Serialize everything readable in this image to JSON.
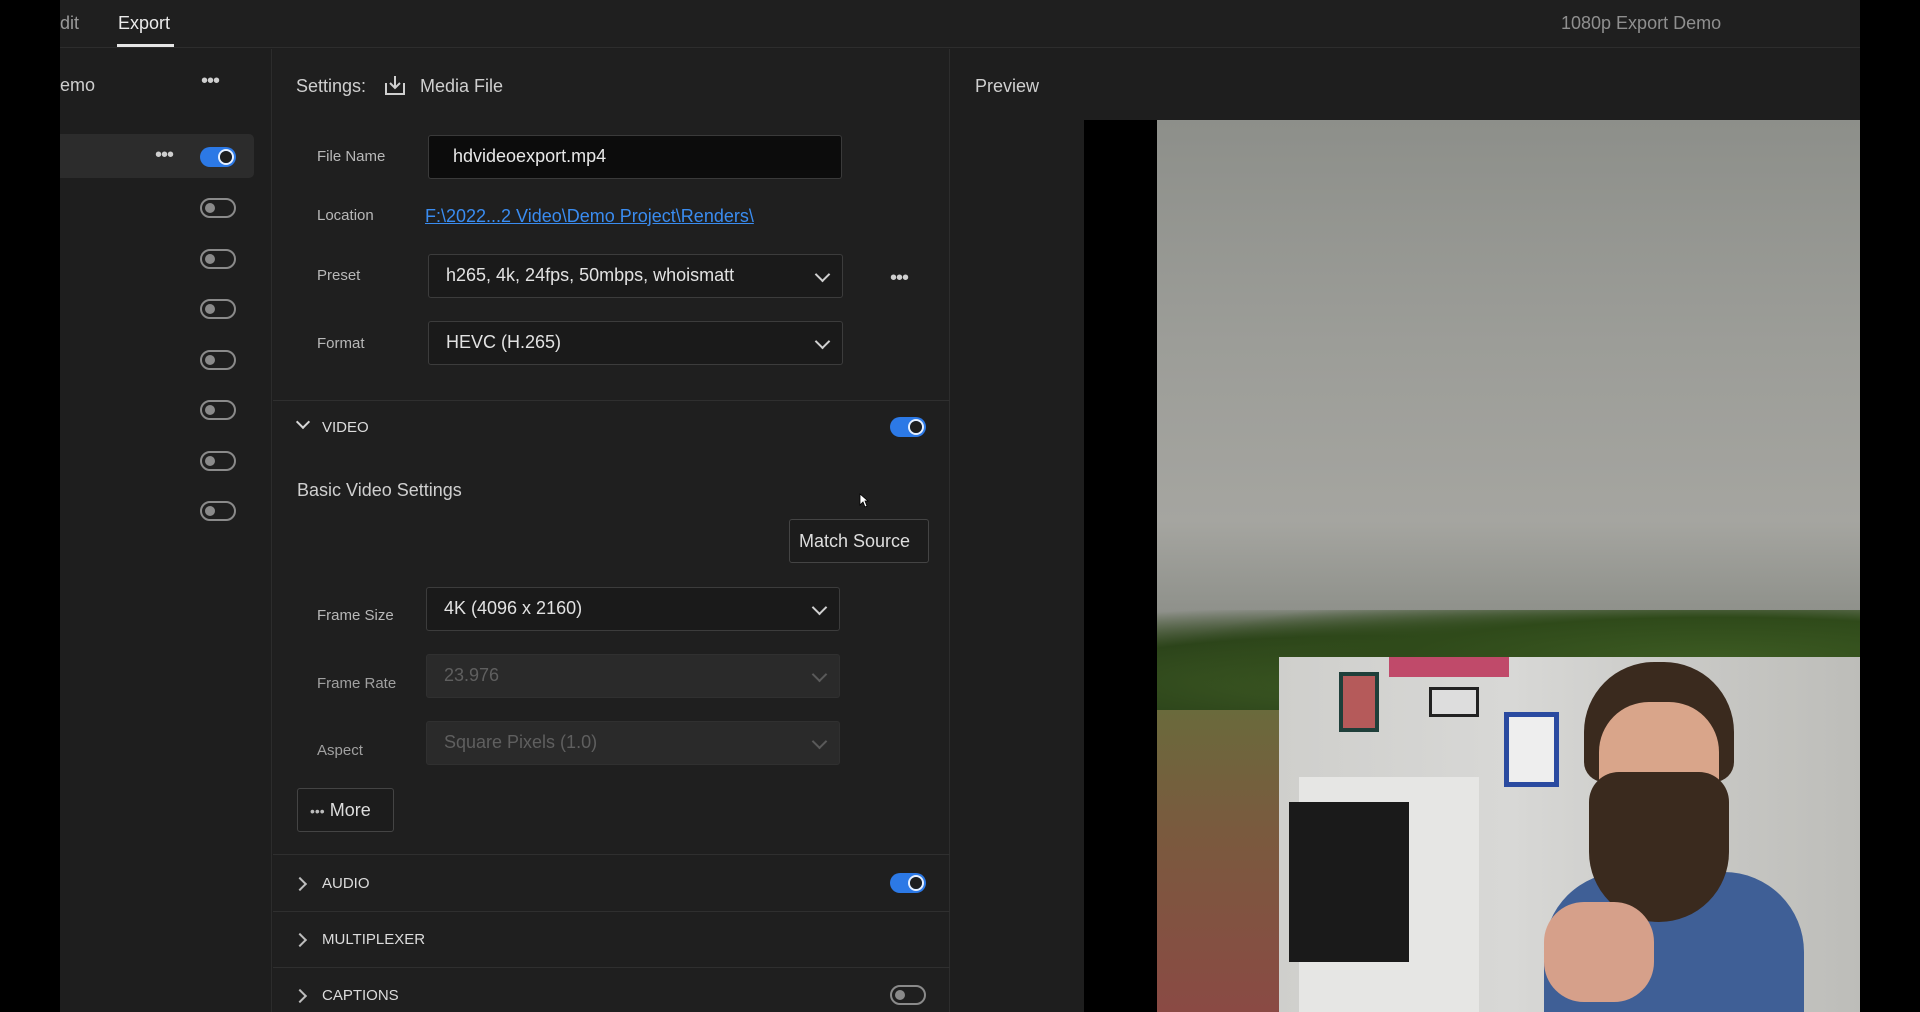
{
  "topbar": {
    "tab_edit": "dit",
    "tab_export": "Export",
    "project_title": "1080p Export Demo"
  },
  "sidebar": {
    "title": "emo",
    "toggles": [
      "on",
      "off",
      "off",
      "off",
      "off",
      "off",
      "off",
      "off"
    ]
  },
  "settings": {
    "label": "Settings:",
    "media_file": "Media File",
    "file_name_label": "File Name",
    "file_name_value": "hdvideoexport.mp4",
    "location_label": "Location",
    "location_value": "F:\\2022...2 Video\\Demo Project\\Renders\\",
    "preset_label": "Preset",
    "preset_value": "h265, 4k, 24fps, 50mbps, whoismatt",
    "format_label": "Format",
    "format_value": "HEVC (H.265)"
  },
  "video": {
    "section_title": "VIDEO",
    "enabled": true,
    "basic_title": "Basic Video Settings",
    "match_source": "Match Source",
    "frame_size_label": "Frame Size",
    "frame_size_value": "4K (4096 x 2160)",
    "frame_size_match_checked": false,
    "frame_rate_label": "Frame Rate",
    "frame_rate_value": "23.976",
    "frame_rate_match_checked": true,
    "aspect_label": "Aspect",
    "aspect_value": "Square Pixels (1.0)",
    "aspect_match_checked": true,
    "more_label": "More"
  },
  "sections": {
    "audio": "AUDIO",
    "audio_enabled": true,
    "multiplexer": "MULTIPLEXER",
    "captions": "CAPTIONS",
    "captions_enabled": false
  },
  "preview": {
    "title": "Preview"
  },
  "colors": {
    "accent": "#2c79e6",
    "link": "#3a8cf0",
    "panel_bg": "#1f1f1f"
  }
}
